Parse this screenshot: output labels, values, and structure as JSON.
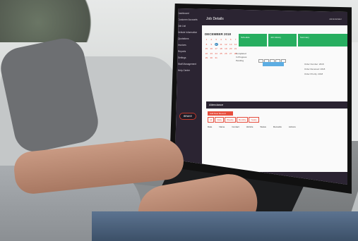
{
  "app": {
    "breadcrumb": "Home > Job Details",
    "title": "Job Details",
    "user_label": "Administrator"
  },
  "sidebar": {
    "items": [
      {
        "label": "Dashboard"
      },
      {
        "label": "Customer Accounts"
      },
      {
        "label": "Job List"
      },
      {
        "label": "Vehicle Information"
      },
      {
        "label": "Quotations"
      },
      {
        "label": "Invoices"
      },
      {
        "label": "Reports"
      },
      {
        "label": "Settings"
      },
      {
        "label": "Staff Management"
      },
      {
        "label": "Help Center"
      }
    ],
    "logo_text": "BRAKE"
  },
  "calendar": {
    "month": "DECEMBER 2018",
    "days": [
      "1",
      "2",
      "3",
      "4",
      "5",
      "6",
      "7",
      "8",
      "9",
      "10",
      "11",
      "12",
      "13",
      "14",
      "15",
      "16",
      "17",
      "18",
      "19",
      "20",
      "21",
      "22",
      "23",
      "24",
      "25",
      "26",
      "27",
      "28",
      "29",
      "30",
      "31"
    ],
    "selected": "10"
  },
  "sections": {
    "schedule_label": "Schedule",
    "history_label": "Job History",
    "summary_label": "Summary",
    "attendance_label": "Attendance"
  },
  "details": {
    "lines": [
      "Order Number: 2018",
      "Order Received: 2018",
      "Order Priority: 2018"
    ]
  },
  "legend": {
    "lines": [
      "Completed",
      "In Progress",
      "Pending"
    ]
  },
  "table": {
    "add_button": "Add New Record",
    "chips": [
      "All",
      "Daily",
      "Weekly",
      "Monthly",
      "Yearly"
    ],
    "headers": [
      "Date",
      "Name",
      "Contact",
      "Vehicle",
      "Status",
      "Remarks",
      "Actions"
    ]
  },
  "colors": {
    "sidebar": "#2b2432",
    "accent_green": "#27ae60",
    "accent_red": "#e74c3c",
    "accent_blue": "#2980b9"
  }
}
